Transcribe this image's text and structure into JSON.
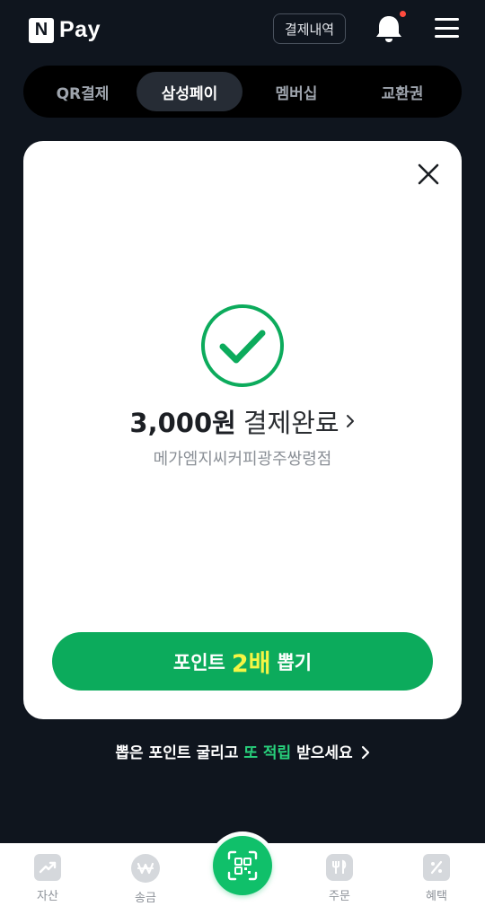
{
  "header": {
    "logo_mark": "N",
    "logo_text": "Pay",
    "history_label": "결제내역",
    "has_notification": true
  },
  "tabs": [
    {
      "label": "QR결제",
      "active": false
    },
    {
      "label": "삼성페이",
      "active": true
    },
    {
      "label": "멤버십",
      "active": false
    },
    {
      "label": "교환권",
      "active": false
    }
  ],
  "result": {
    "amount": "3,000원",
    "status": "결제완료",
    "store": "메가엠지씨커피광주쌍령점"
  },
  "cta": {
    "prefix": "포인트",
    "highlight": "2배",
    "suffix": "뽑기"
  },
  "promo": {
    "part1": "뽑은 포인트 굴리고",
    "highlight": "또 적립",
    "part2": "받으세요"
  },
  "bottom_nav": [
    {
      "label": "자산",
      "icon": "chart-up-icon"
    },
    {
      "label": "송금",
      "icon": "won-icon"
    },
    {
      "label": "",
      "icon": "qr-scan-icon"
    },
    {
      "label": "주문",
      "icon": "fork-knife-icon"
    },
    {
      "label": "혜택",
      "icon": "percent-icon"
    }
  ],
  "colors": {
    "background": "#0f151e",
    "accent_green": "#0cab5c",
    "highlight_yellow": "#f5f544",
    "notification_red": "#ff4b3e"
  }
}
